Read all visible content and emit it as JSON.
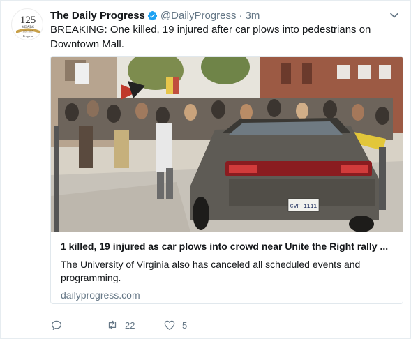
{
  "account": {
    "name": "The Daily Progress",
    "handle": "@DailyProgress",
    "separator": "·",
    "time": "3m",
    "avatar_text": {
      "number": "125",
      "years": "YEARS",
      "range": "1892-2017",
      "brand": "Progress"
    }
  },
  "tweet": {
    "text": "BREAKING: One killed, 19 injured after car plows into pedestrians on Downtown Mall."
  },
  "card": {
    "title": "1 killed, 19 injured as car plows into crowd near Unite the Right rally ...",
    "description": "The University of Virginia also has canceled all scheduled events and programming.",
    "domain": "dailyprogress.com",
    "plate": "CVF 1111"
  },
  "actions": {
    "retweets": "22",
    "likes": "5"
  },
  "colors": {
    "verified": "#1da1f2",
    "muted": "#657786",
    "border": "#e1e8ed",
    "text": "#14171a"
  }
}
